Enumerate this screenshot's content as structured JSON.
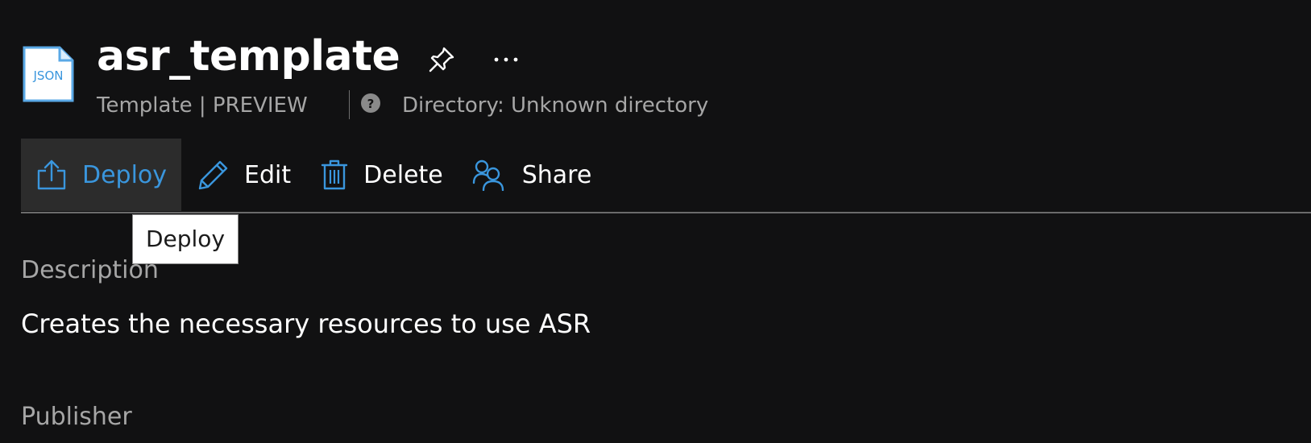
{
  "header": {
    "file_icon_text": "JSON",
    "title": "asr_template",
    "subtitle": "Template | PREVIEW",
    "directory": "Directory: Unknown directory",
    "more_label": "···"
  },
  "toolbar": {
    "deploy_label": "Deploy",
    "edit_label": "Edit",
    "delete_label": "Delete",
    "share_label": "Share"
  },
  "tooltip": {
    "text": "Deploy"
  },
  "details": {
    "description_label": "Description",
    "description_value": "Creates the necessary resources to use ASR",
    "publisher_label": "Publisher"
  },
  "icons": {
    "file": "json-file-icon",
    "pin": "pin-icon",
    "more": "more-icon",
    "help": "help-icon",
    "deploy": "upload-icon",
    "edit": "pencil-icon",
    "delete": "trash-icon",
    "share": "people-icon"
  },
  "colors": {
    "background": "#111112",
    "accent": "#3a96dd",
    "active_button_bg": "#2c2c2c",
    "muted_text": "#a6a6a6"
  }
}
